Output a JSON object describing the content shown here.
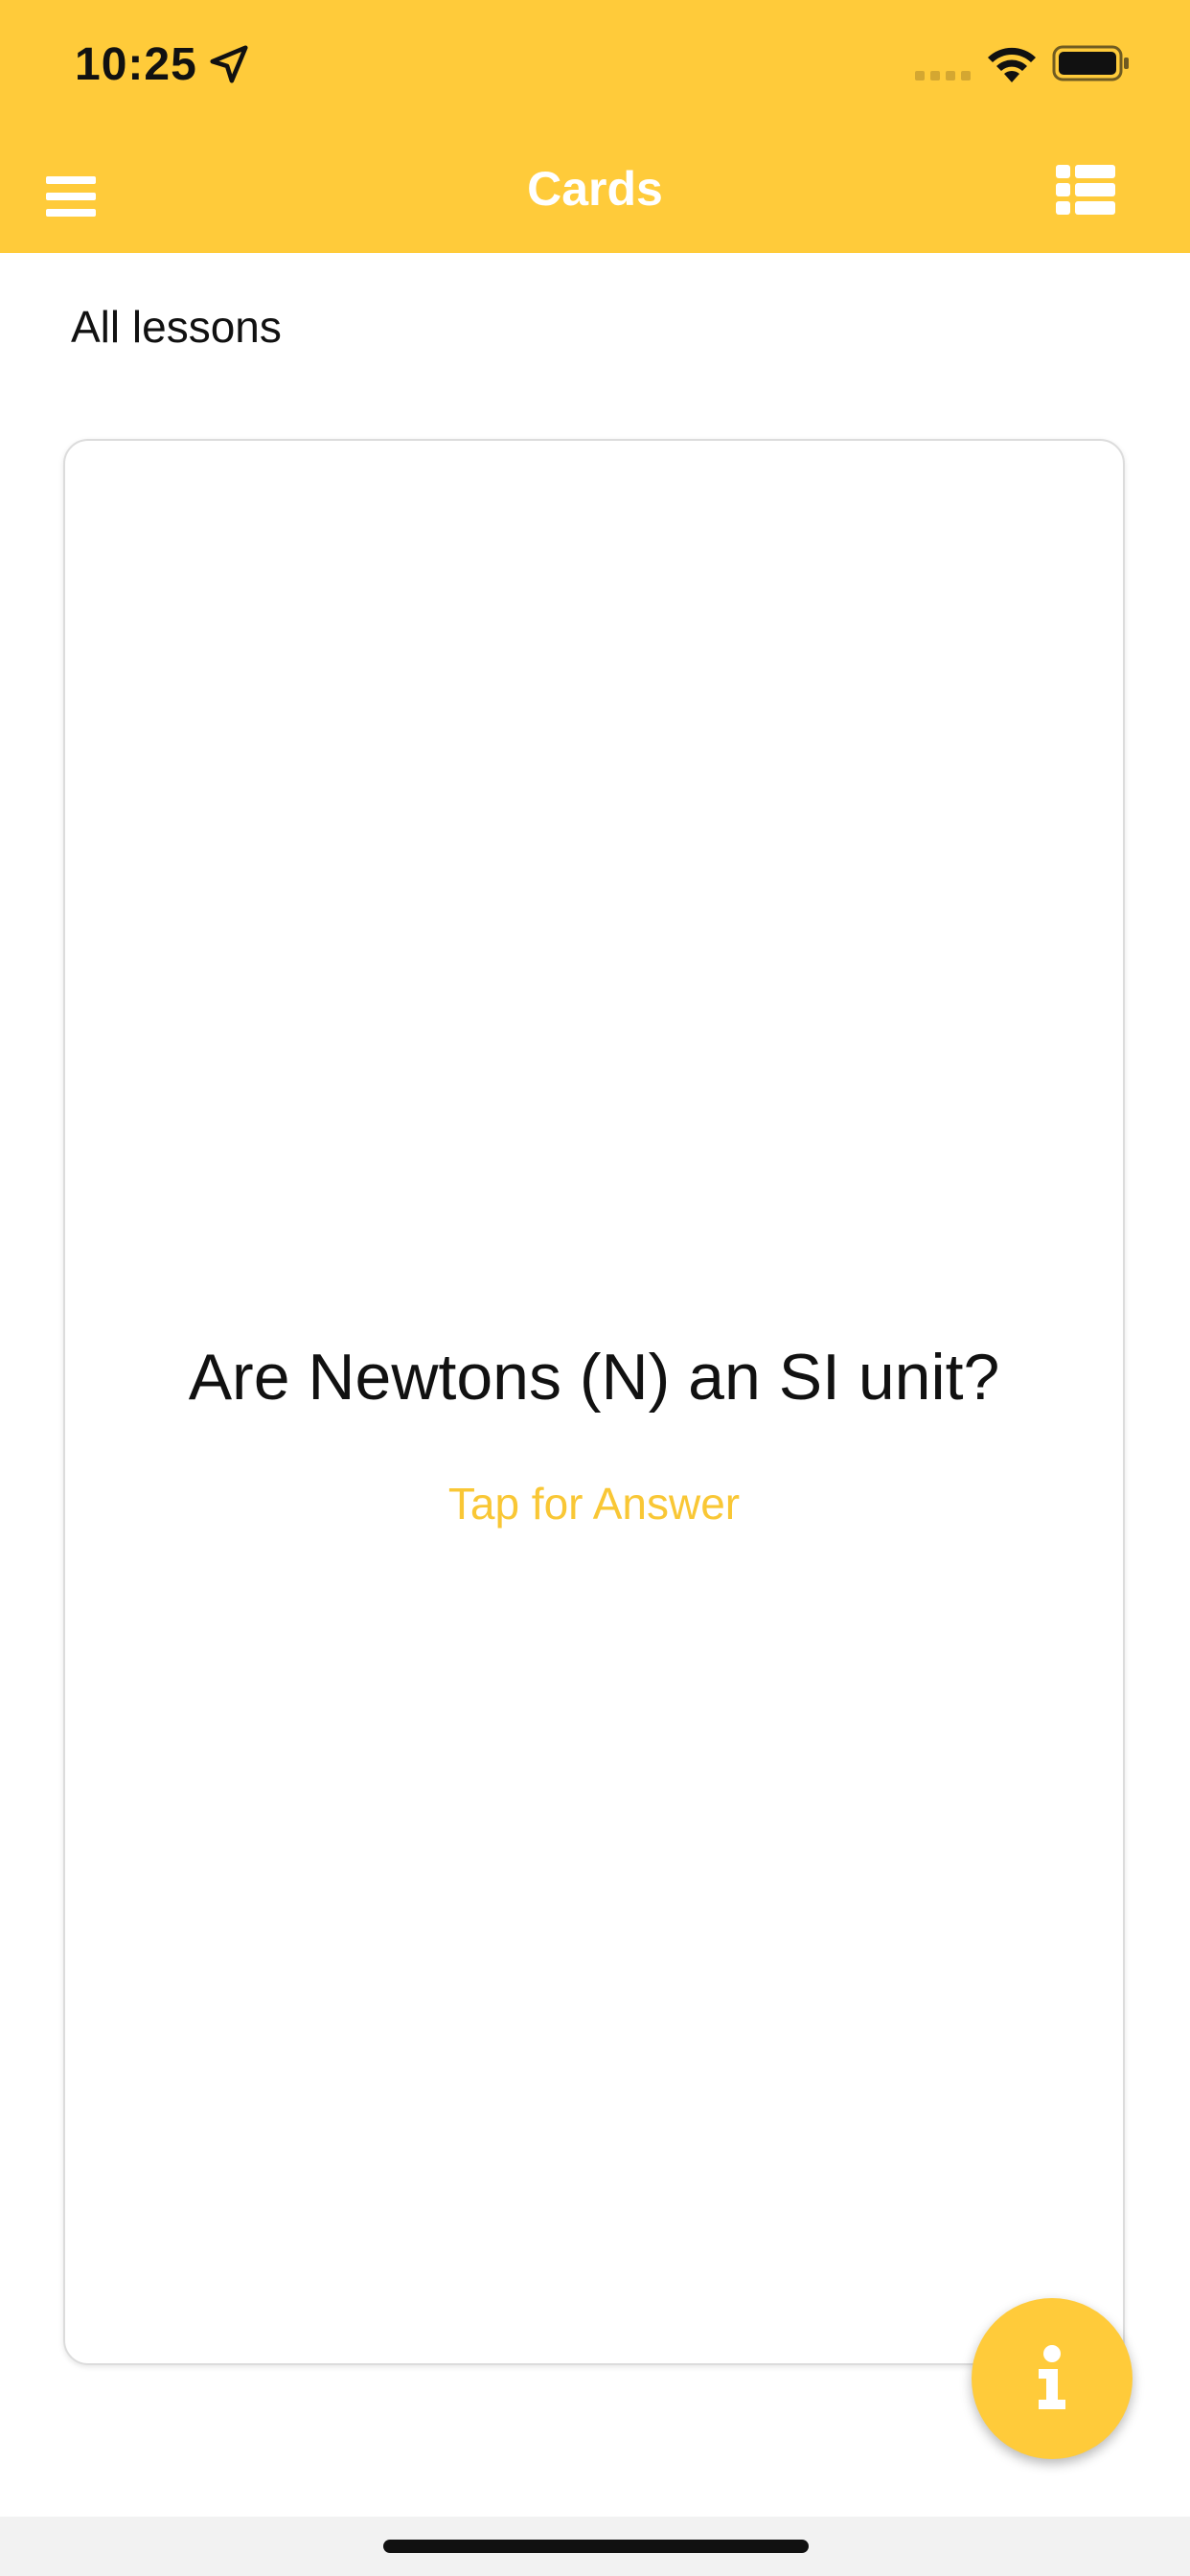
{
  "status_bar": {
    "time": "10:25",
    "icons": [
      "location-arrow-icon",
      "signal-icon",
      "wifi-icon",
      "battery-icon"
    ]
  },
  "nav": {
    "title": "Cards",
    "left_icon": "hamburger-menu-icon",
    "right_icon": "list-icon"
  },
  "filter": {
    "label": "All lessons"
  },
  "card": {
    "question": "Are Newtons (N) an SI unit?",
    "action_label": "Tap for Answer"
  },
  "fab": {
    "icon": "info-icon"
  },
  "colors": {
    "accent": "#FFCB3A",
    "accent_text": "#F9C735",
    "title_text": "#FFFFFF",
    "body_text": "#111111"
  }
}
